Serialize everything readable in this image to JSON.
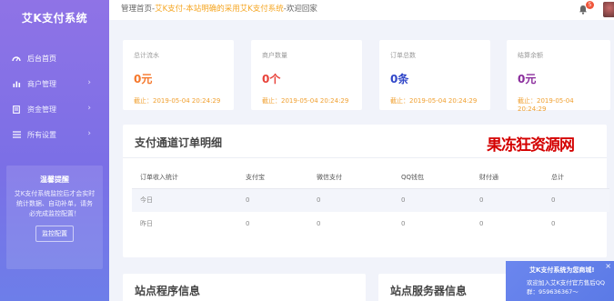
{
  "brand": "艾K支付系统",
  "sidebar": {
    "items": [
      {
        "label": "后台首页",
        "icon": "dashboard-icon"
      },
      {
        "label": "商户管理",
        "icon": "bar-chart-icon"
      },
      {
        "label": "资金管理",
        "icon": "document-icon"
      },
      {
        "label": "所有设置",
        "icon": "list-icon"
      }
    ],
    "notice": {
      "title": "温馨提醒",
      "text": "艾K支付系统监控后才会实时统计数据、自动补单，请务必完成监控配置！",
      "button": "监控配置"
    }
  },
  "header": {
    "crumb_home": "管理首页-",
    "crumb_site": "艾K支付-本站明确的采用艾K支付系统",
    "crumb_welcome": "-欢迎回家",
    "badge_count": "5"
  },
  "stats": [
    {
      "label": "总计流水",
      "value": "0元",
      "time": "截止：2019-05-04 20:24:29",
      "color": "#f5772a"
    },
    {
      "label": "商户数量",
      "value": "0个",
      "time": "截止：2019-05-04 20:24:29",
      "color": "#e8423a"
    },
    {
      "label": "订单总数",
      "value": "0条",
      "time": "截止：2019-05-04 20:24:29",
      "color": "#3046c8"
    },
    {
      "label": "结算余额",
      "value": "0元",
      "time": "截止：2019-05-04 20:24:29",
      "color": "#8a2c9c"
    }
  ],
  "orders": {
    "title": "支付通道订单明细",
    "columns": [
      "订单收入统计",
      "支付宝",
      "微信支付",
      "QQ钱包",
      "财付通",
      "总计"
    ],
    "rows": [
      [
        "今日",
        "0",
        "0",
        "0",
        "0",
        "0"
      ],
      [
        "昨日",
        "0",
        "0",
        "0",
        "0",
        "0"
      ]
    ]
  },
  "bottom": {
    "program_title": "站点程序信息",
    "server_title": "站点服务器信息"
  },
  "promo": {
    "title": "艾K支付系统为您商城!",
    "line1": "欢迎加入艾K支付官方售后QQ",
    "line2": "群：959636367～",
    "close": "×"
  }
}
